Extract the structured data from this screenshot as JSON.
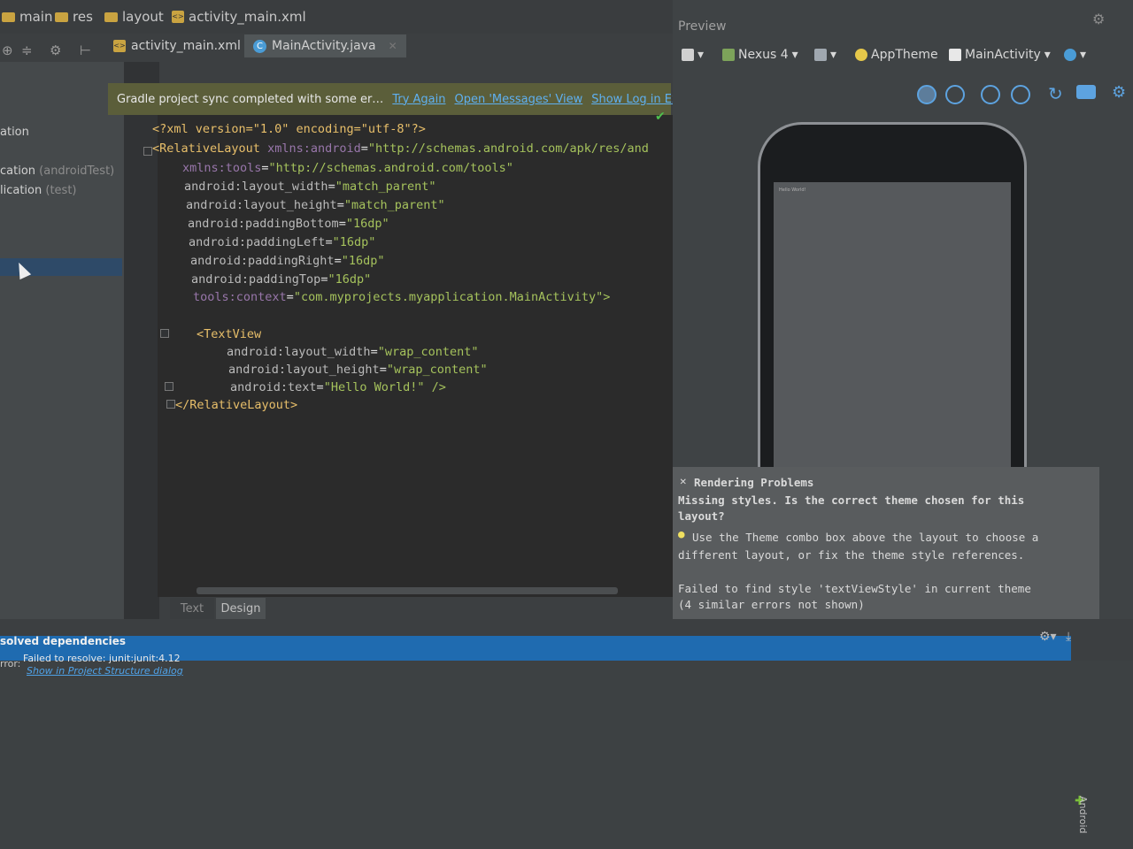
{
  "breadcrumb": {
    "items": [
      "main",
      "res",
      "layout",
      "activity_main.xml"
    ]
  },
  "tabs": [
    {
      "label": "activity_main.xml",
      "active": false
    },
    {
      "label": "MainActivity.java",
      "active": true
    }
  ],
  "sync_bar": {
    "message": "Gradle project sync completed with some er…",
    "try_again": "Try Again",
    "open_messages": "Open 'Messages' View",
    "show_log": "Show Log in Explorer"
  },
  "project_tree": [
    {
      "label": "ation",
      "sub": ""
    },
    {
      "label": "cation",
      "sub": "(androidTest)"
    },
    {
      "label": "lication",
      "sub": "(test)"
    }
  ],
  "code_lines": [
    {
      "xml_decl": "<?xml version=\"1.0\" encoding=\"utf-8\"?>"
    },
    {
      "tag_open": "<RelativeLayout",
      "attr": "xmlns:android",
      "val": "\"http://schemas.android.com/apk/res/and"
    },
    {
      "attr": "xmlns:tools",
      "val": "\"http://schemas.android.com/tools\""
    },
    {
      "attr": "android:layout_width",
      "val": "\"match_parent\""
    },
    {
      "attr": "android:layout_height",
      "val": "\"match_parent\""
    },
    {
      "attr": "android:paddingBottom",
      "val": "\"16dp\""
    },
    {
      "attr": "android:paddingLeft",
      "val": "\"16dp\""
    },
    {
      "attr": "android:paddingRight",
      "val": "\"16dp\""
    },
    {
      "attr": "android:paddingTop",
      "val": "\"16dp\""
    },
    {
      "attr": "tools:context",
      "val": "\"com.myprojects.myapplication.MainActivity\">"
    },
    {
      "tag_open": "<TextView"
    },
    {
      "attr": "android:layout_width",
      "val": "\"wrap_content\""
    },
    {
      "attr": "android:layout_height",
      "val": "\"wrap_content\""
    },
    {
      "attr": "android:text",
      "val": "\"Hello World!\" />"
    },
    {
      "tag_open": "</RelativeLayout>"
    }
  ],
  "editor_tabs": {
    "text": "Text",
    "design": "Design"
  },
  "preview": {
    "title": "Preview",
    "device": "Nexus 4",
    "theme": "AppTheme",
    "activity": "MainActivity",
    "screen_text": "Hello World!"
  },
  "rendering_problems": {
    "title": "Rendering Problems",
    "line1": "Missing styles. Is the correct theme chosen for this",
    "line2": "layout?",
    "line3": "Use the Theme combo box above the layout to choose a",
    "line4": "different layout, or fix the theme style references.",
    "line5": "Failed to find style 'textViewStyle' in current theme",
    "line6": "(4 similar errors not shown)"
  },
  "messages": {
    "title": "solved dependencies",
    "label": "rror:",
    "text": "Failed to resolve: junit:junit:4.12",
    "link": "Show in Project Structure dialog"
  },
  "side_panel": {
    "android": "Android"
  }
}
